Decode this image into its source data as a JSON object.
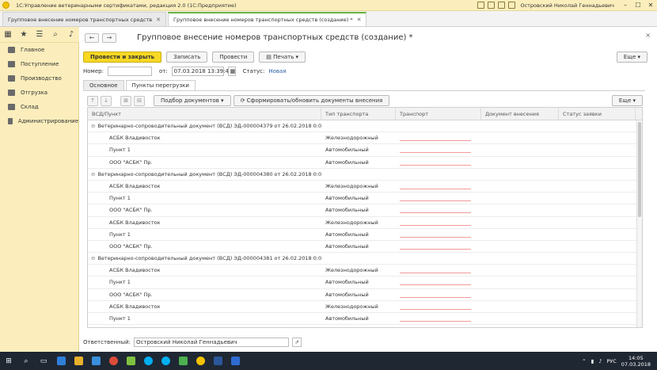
{
  "window": {
    "app_title": "1С:Управление ветеринарными сертификатами, редакция 2.0 (1С:Предприятие)",
    "user": "Островский Николай Геннадьевич",
    "min": "–",
    "max": "☐",
    "close": "✕"
  },
  "tabs": [
    {
      "label": "Групповое внесение номеров транспортных средств",
      "close": "✕"
    },
    {
      "label": "Групповое внесение номеров транспортных средств (создание) *",
      "close": "✕"
    }
  ],
  "sidebar": {
    "items": [
      {
        "label": "Главное"
      },
      {
        "label": "Поступление"
      },
      {
        "label": "Производство"
      },
      {
        "label": "Отгрузка"
      },
      {
        "label": "Склад"
      },
      {
        "label": "Администрирование"
      }
    ]
  },
  "form": {
    "title": "Групповое внесение номеров транспортных средств (создание) *",
    "back": "←",
    "forward": "→",
    "close": "×",
    "buttons": {
      "post_close": "Провести и закрыть",
      "save": "Записать",
      "post": "Провести",
      "print": "Печать",
      "more": "Еще"
    },
    "number_label": "Номер:",
    "number_value": "",
    "date_label": "от:",
    "date_value": "07.03.2018 13:39:43",
    "status_label": "Статус:",
    "status_value": "Новая",
    "inner_tabs": [
      "Основное",
      "Пункты перегрузки"
    ],
    "toolbar": {
      "select_docs": "Подбор документов",
      "generate": "Сформировать/обновить документы внесения",
      "more": "Еще"
    },
    "columns": [
      "ВСД/Пункт",
      "Тип транспорта",
      "Транспорт",
      "Документ внесения",
      "Статус заявки"
    ],
    "rows": [
      {
        "kind": "group",
        "c1": "Ветеринарно-сопроводительный документ (ВСД) ЭД-000004379 от 26.02.2018 0:00:00",
        "c2": ""
      },
      {
        "kind": "item",
        "c1": "АСБК Владивосток",
        "c2": "Железнодорожный"
      },
      {
        "kind": "item",
        "c1": "Пункт 1",
        "c2": "Автомобильный"
      },
      {
        "kind": "item",
        "c1": "ООО \"АСБК\" Пр.",
        "c2": "Автомобильный"
      },
      {
        "kind": "group",
        "c1": "Ветеринарно-сопроводительный документ (ВСД) ЭД-000004380 от 26.02.2018 0:00:00",
        "c2": ""
      },
      {
        "kind": "item",
        "c1": "АСБК Владивосток",
        "c2": "Железнодорожный"
      },
      {
        "kind": "item",
        "c1": "Пункт 1",
        "c2": "Автомобильный"
      },
      {
        "kind": "item",
        "c1": "ООО \"АСБК\" Пр.",
        "c2": "Автомобильный"
      },
      {
        "kind": "item",
        "c1": "АСБК Владивосток",
        "c2": "Железнодорожный"
      },
      {
        "kind": "item",
        "c1": "Пункт 1",
        "c2": "Автомобильный"
      },
      {
        "kind": "item",
        "c1": "ООО \"АСБК\" Пр.",
        "c2": "Автомобильный"
      },
      {
        "kind": "group",
        "c1": "Ветеринарно-сопроводительный документ (ВСД) ЭД-000004381 от 26.02.2018 0:00:00",
        "c2": ""
      },
      {
        "kind": "item",
        "c1": "АСБК Владивосток",
        "c2": "Железнодорожный"
      },
      {
        "kind": "item",
        "c1": "Пункт 1",
        "c2": "Автомобильный"
      },
      {
        "kind": "item",
        "c1": "ООО \"АСБК\" Пр.",
        "c2": "Автомобильный"
      },
      {
        "kind": "item",
        "c1": "АСБК Владивосток",
        "c2": "Железнодорожный"
      },
      {
        "kind": "item",
        "c1": "Пункт 1",
        "c2": "Автомобильный"
      }
    ],
    "responsible_label": "Ответственный:",
    "responsible_value": "Островский Николай Геннадьевич"
  },
  "taskbar": {
    "lang": "РУС",
    "time": "14:05",
    "date": "07.03.2018"
  }
}
